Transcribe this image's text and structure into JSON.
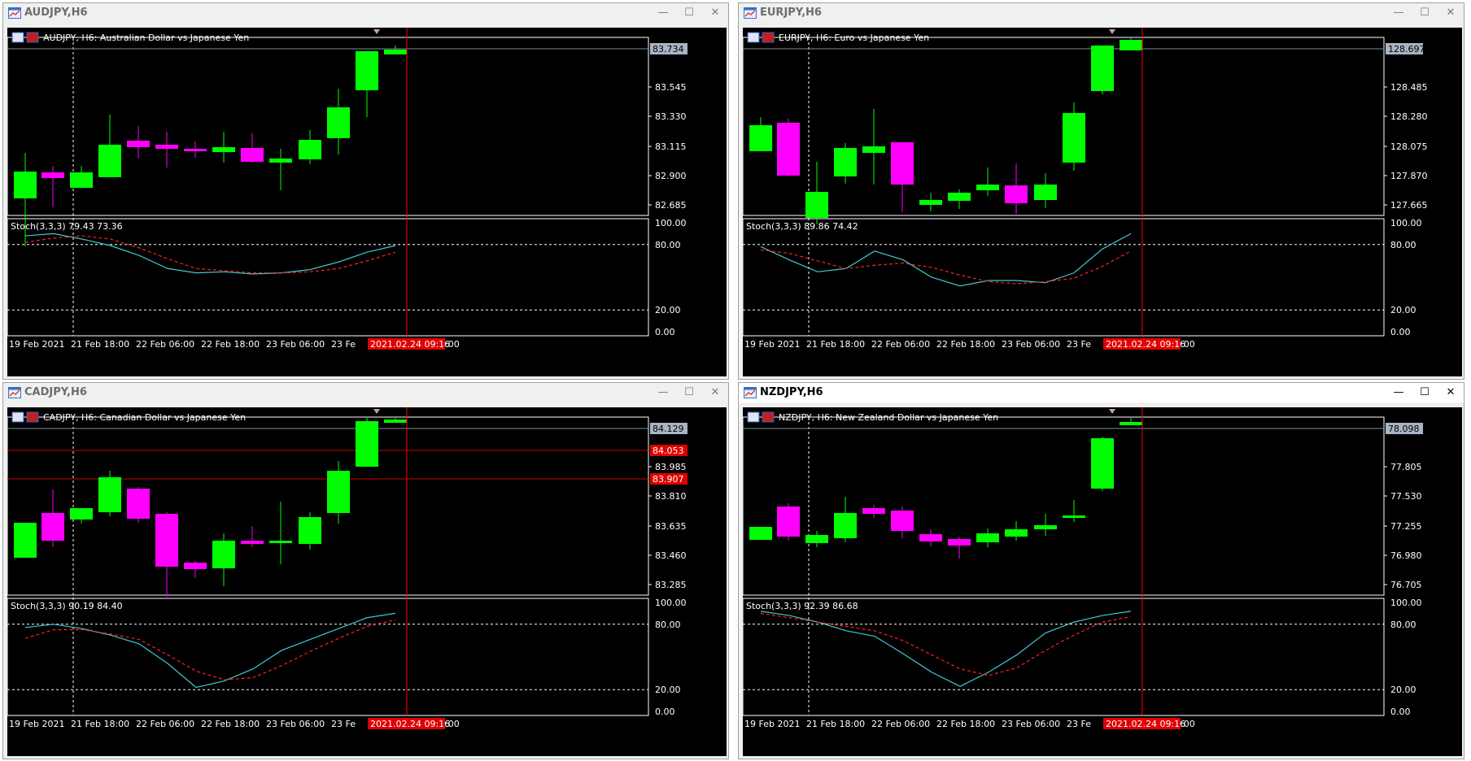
{
  "colors": {
    "bull": "#00ff00",
    "bear": "#ff00ff",
    "main_line": "#40c8d0",
    "signal_line": "#ff2020",
    "grid": "#ffffff",
    "cursor": "#ff0000"
  },
  "controls": {
    "minimize": "—",
    "maximize": "☐",
    "close": "✕"
  },
  "windows": [
    {
      "id": "audjpy",
      "title": "AUDJPY,H6",
      "active": false,
      "chart_label": "AUDJPY, H6:  Australian Dollar vs Japanese Yen",
      "price_ticks": [
        "83.545",
        "83.330",
        "83.115",
        "82.900",
        "82.685"
      ],
      "current_price": "83.734",
      "indicator_label": "Stoch(3,3,3) 79.43 73.36",
      "stoch_ticks": [
        "100.00",
        "80.00",
        "20.00",
        "0.00"
      ],
      "time_ticks": [
        "19 Feb 2021",
        "21 Feb 18:00",
        "22 Feb 06:00",
        "22 Feb 18:00",
        "23 Feb 06:00",
        "23 Fe"
      ],
      "time_suffix": ":00",
      "cursor_time": "2021.02.24 09:16",
      "price_lines": []
    },
    {
      "id": "eurjpy",
      "title": "EURJPY,H6",
      "active": false,
      "chart_label": "EURJPY, H6:  Euro vs Japanese Yen",
      "price_ticks": [
        "128.485",
        "128.280",
        "128.075",
        "127.870",
        "127.665"
      ],
      "current_price": "128.697",
      "indicator_label": "Stoch(3,3,3) 89.86 74.42",
      "stoch_ticks": [
        "100.00",
        "80.00",
        "20.00",
        "0.00"
      ],
      "time_ticks": [
        "19 Feb 2021",
        "21 Feb 18:00",
        "22 Feb 06:00",
        "22 Feb 18:00",
        "23 Feb 06:00",
        "23 Fe"
      ],
      "time_suffix": ":00",
      "cursor_time": "2021.02.24 09:16",
      "price_lines": []
    },
    {
      "id": "cadjpy",
      "title": "CADJPY,H6",
      "active": false,
      "chart_label": "CADJPY, H6:  Canadian Dollar vs Japanese Yen",
      "price_ticks": [
        "83.985",
        "83.810",
        "83.635",
        "83.460",
        "83.285"
      ],
      "current_price": "84.129",
      "indicator_label": "Stoch(3,3,3) 90.19 84.40",
      "stoch_ticks": [
        "100.00",
        "80.00",
        "20.00",
        "0.00"
      ],
      "time_ticks": [
        "19 Feb 2021",
        "21 Feb 18:00",
        "22 Feb 06:00",
        "22 Feb 18:00",
        "23 Feb 06:00",
        "23 Fe"
      ],
      "time_suffix": ":00",
      "cursor_time": "2021.02.24 09:16",
      "price_lines": [
        "84.053",
        "83.907"
      ]
    },
    {
      "id": "nzdjpy",
      "title": "NZDJPY,H6",
      "active": true,
      "chart_label": "NZDJPY, H6:  New Zealand Dollar vs Japanese Yen",
      "price_ticks": [
        "77.805",
        "77.530",
        "77.255",
        "76.980",
        "76.705"
      ],
      "current_price": "78.098",
      "indicator_label": "Stoch(3,3,3) 92.39 86.68",
      "stoch_ticks": [
        "100.00",
        "80.00",
        "20.00",
        "0.00"
      ],
      "time_ticks": [
        "19 Feb 2021",
        "21 Feb 18:00",
        "22 Feb 06:00",
        "22 Feb 18:00",
        "23 Feb 06:00",
        "23 Fe"
      ],
      "time_suffix": ":00",
      "cursor_time": "2021.02.24 09:16",
      "price_lines": []
    }
  ]
}
